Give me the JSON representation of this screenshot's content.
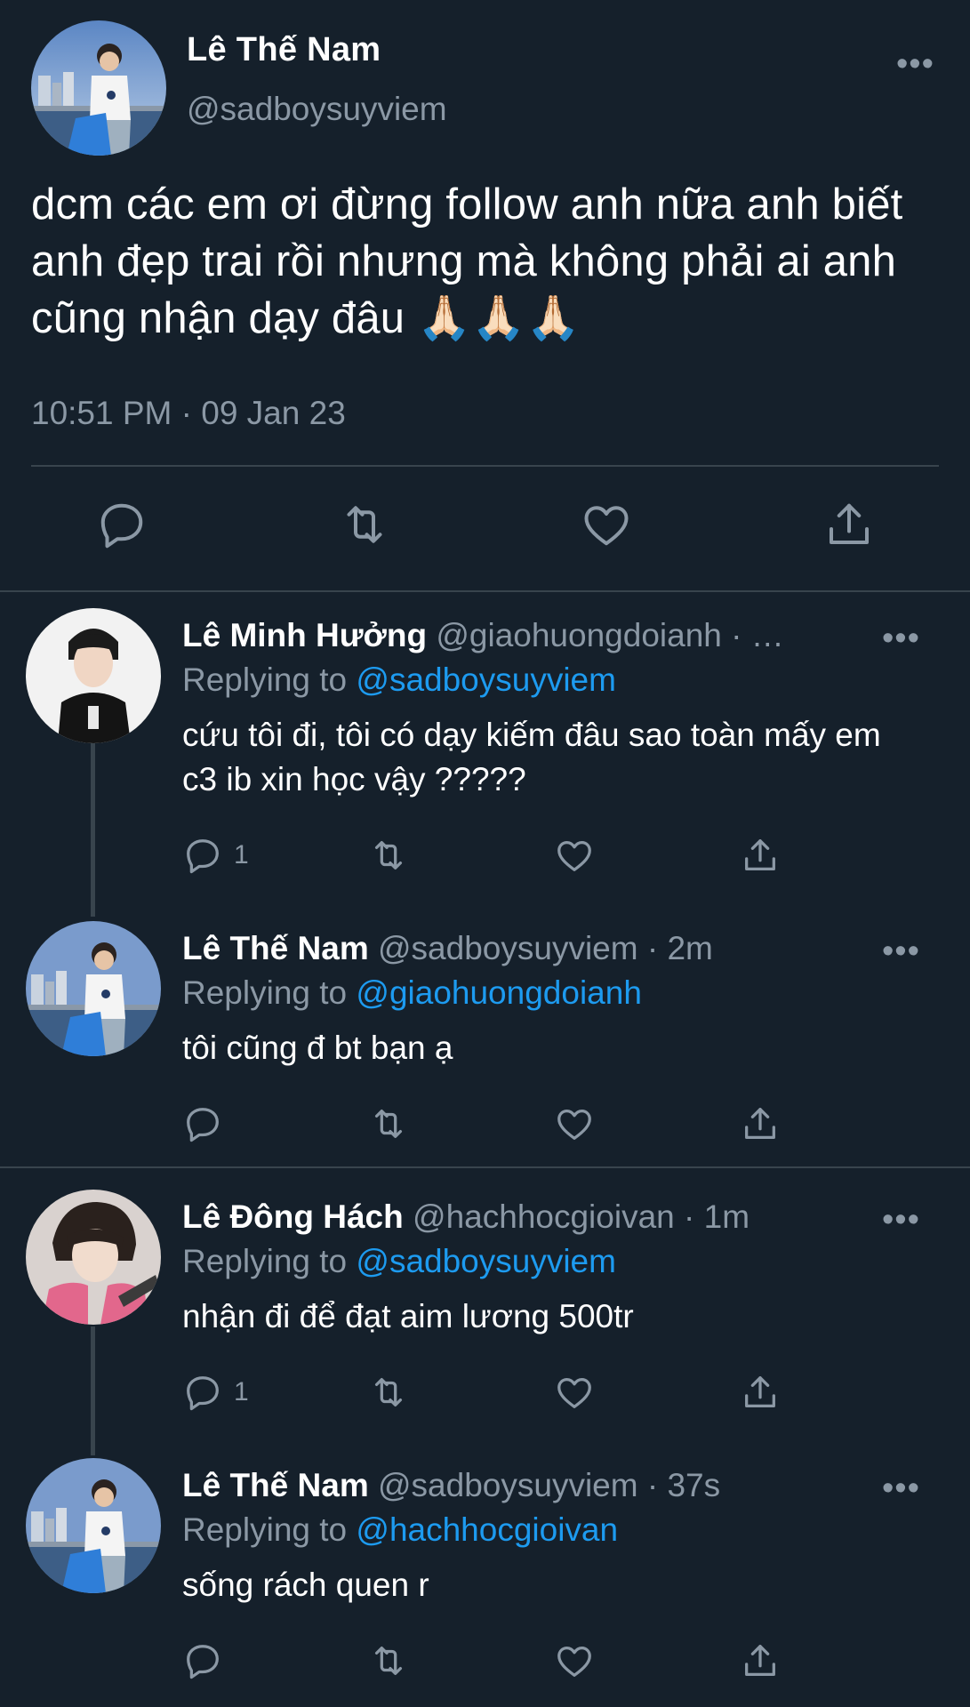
{
  "main_tweet": {
    "name": "Lê Thế Nam",
    "handle": "@sadboysuyviem",
    "more": "•••",
    "text": "dcm các em ơi đừng follow anh nữa anh biết anh đẹp trai rồi nhưng mà không phải ai anh cũng nhận dạy đâu 🙏🏻🙏🏻🙏🏻",
    "timestamp": "10:51 PM · 09 Jan 23"
  },
  "replies": [
    {
      "name": "Lê Minh Hưởng",
      "handle_time": "@giaohuongdoianh · …",
      "replying_prefix": "Replying to ",
      "replying_to": "@sadboysuyviem",
      "text": "cứu tôi đi, tôi có dạy kiếm đâu sao toàn mấy em c3 ib xin học vậy ?????",
      "reply_count": "1",
      "more": "•••"
    },
    {
      "name": "Lê Thế Nam",
      "handle_time": "@sadboysuyviem · 2m",
      "replying_prefix": "Replying to ",
      "replying_to": "@giaohuongdoianh",
      "text": "tôi cũng đ bt bạn ạ",
      "reply_count": "",
      "more": "•••"
    },
    {
      "name": "Lê Đông Hách",
      "handle_time": "@hachhocgioivan · 1m",
      "replying_prefix": "Replying to ",
      "replying_to": "@sadboysuyviem",
      "text": "nhận đi để đạt aim lương 500tr",
      "reply_count": "1",
      "more": "•••"
    },
    {
      "name": "Lê Thế Nam",
      "handle_time": "@sadboysuyviem · 37s",
      "replying_prefix": "Replying to ",
      "replying_to": "@hachhocgioivan",
      "text": "sống rách quen r",
      "reply_count": "",
      "more": "•••"
    }
  ],
  "colors": {
    "background": "#15202b",
    "secondary_text": "#8b98a5",
    "link": "#1d9bf0",
    "divider": "#38444d"
  },
  "icons": [
    "reply-icon",
    "retweet-icon",
    "like-icon",
    "share-icon",
    "more-icon",
    "avatar"
  ]
}
